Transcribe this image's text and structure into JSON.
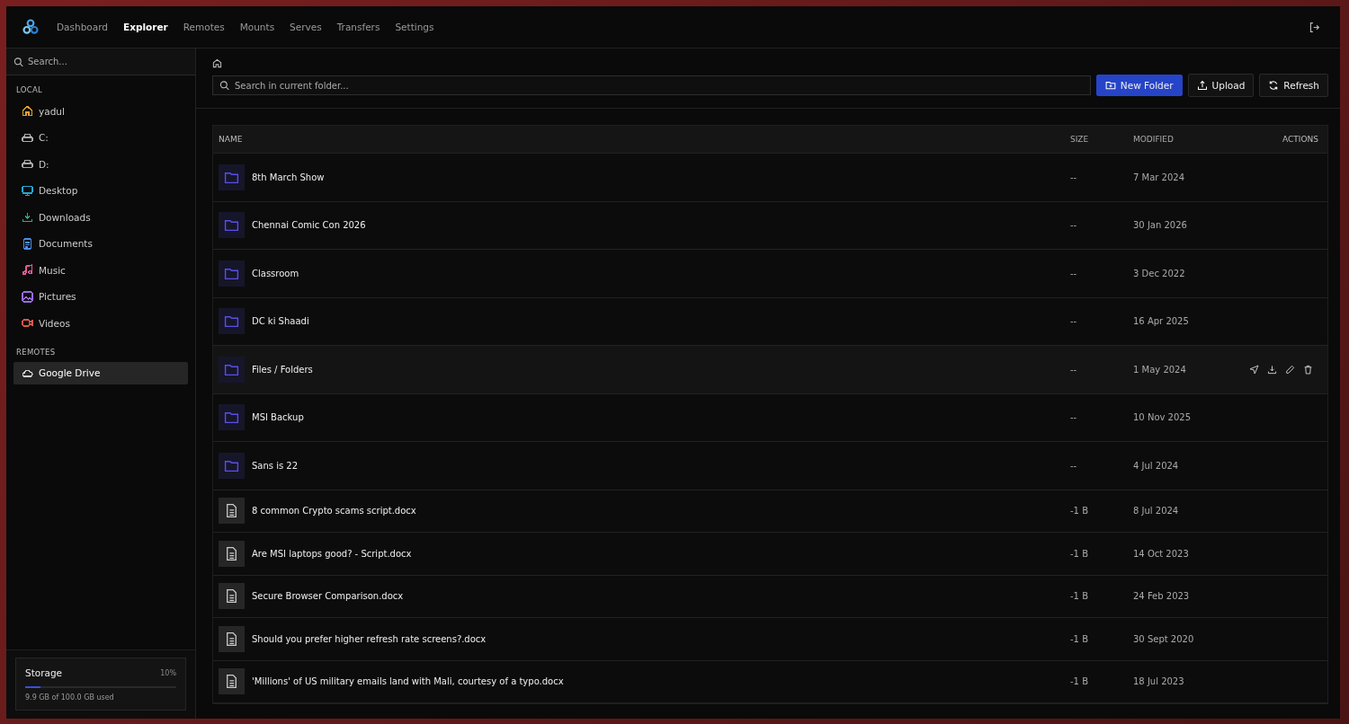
{
  "nav": {
    "tabs": [
      {
        "label": "Dashboard",
        "selected": false
      },
      {
        "label": "Explorer",
        "selected": true
      },
      {
        "label": "Remotes",
        "selected": false
      },
      {
        "label": "Mounts",
        "selected": false
      },
      {
        "label": "Serves",
        "selected": false
      },
      {
        "label": "Transfers",
        "selected": false
      },
      {
        "label": "Settings",
        "selected": false
      }
    ]
  },
  "sidebar": {
    "search": {
      "placeholder": "Search..."
    },
    "sections": [
      {
        "title": "LOCAL",
        "items": [
          {
            "label": "yadul",
            "kind": "home",
            "color": "#e0a030",
            "selected": false
          },
          {
            "label": "C:",
            "kind": "drive",
            "color": "#a8a8a8",
            "selected": false
          },
          {
            "label": "D:",
            "kind": "drive",
            "color": "#a8a8a8",
            "selected": false
          },
          {
            "label": "Desktop",
            "kind": "desktop",
            "color": "#22a8d8",
            "selected": false
          },
          {
            "label": "Downloads",
            "kind": "download",
            "color": "#22b573",
            "selected": false
          },
          {
            "label": "Documents",
            "kind": "document",
            "color": "#4a8ee8",
            "selected": false
          },
          {
            "label": "Music",
            "kind": "music",
            "color": "#e05a9a",
            "selected": false
          },
          {
            "label": "Pictures",
            "kind": "picture",
            "color": "#9b6be8",
            "selected": false
          },
          {
            "label": "Videos",
            "kind": "video",
            "color": "#e0554a",
            "selected": false
          }
        ]
      },
      {
        "title": "REMOTES",
        "items": [
          {
            "label": "Google Drive",
            "kind": "cloud",
            "color": "#d0d0d0",
            "selected": true
          }
        ]
      }
    ],
    "storage": {
      "title": "Storage",
      "percent": "10%",
      "level": 0.1,
      "usage": "9.9 GB of 100.0 GB used"
    }
  },
  "toolbar": {
    "search": {
      "placeholder": "Search in current folder..."
    },
    "buttons": [
      {
        "label": "New Folder",
        "kind": "new-folder",
        "primary": true
      },
      {
        "label": "Upload",
        "kind": "upload",
        "primary": false
      },
      {
        "label": "Refresh",
        "kind": "refresh",
        "primary": false
      }
    ]
  },
  "table": {
    "columns": [
      "NAME",
      "SIZE",
      "MODIFIED",
      "ACTIONS"
    ],
    "rows": [
      {
        "kind": "folder",
        "name": "8th March Show",
        "size": "--",
        "modified": "7 Mar 2024",
        "hovered": false
      },
      {
        "kind": "folder",
        "name": "Chennai Comic Con 2026",
        "size": "--",
        "modified": "30 Jan 2026",
        "hovered": false
      },
      {
        "kind": "folder",
        "name": "Classroom",
        "size": "--",
        "modified": "3 Dec 2022",
        "hovered": false
      },
      {
        "kind": "folder",
        "name": "DC ki Shaadi",
        "size": "--",
        "modified": "16 Apr 2025",
        "hovered": false
      },
      {
        "kind": "folder",
        "name": "Files / Folders",
        "size": "--",
        "modified": "1 May 2024",
        "hovered": true
      },
      {
        "kind": "folder",
        "name": "MSI Backup",
        "size": "--",
        "modified": "10 Nov 2025",
        "hovered": false
      },
      {
        "kind": "folder",
        "name": "Sans is 22",
        "size": "--",
        "modified": "4 Jul 2024",
        "hovered": false
      },
      {
        "kind": "file",
        "name": "8 common Crypto scams script.docx",
        "size": "-1 B",
        "modified": "8 Jul 2024",
        "hovered": false
      },
      {
        "kind": "file",
        "name": "Are MSI laptops good? - Script.docx",
        "size": "-1 B",
        "modified": "14 Oct 2023",
        "hovered": false
      },
      {
        "kind": "file",
        "name": "Secure Browser Comparison.docx",
        "size": "-1 B",
        "modified": "24 Feb 2023",
        "hovered": false
      },
      {
        "kind": "file",
        "name": "Should you prefer higher refresh rate screens?.docx",
        "size": "-1 B",
        "modified": "30 Sept 2020",
        "hovered": false
      },
      {
        "kind": "file",
        "name": "'Millions' of US military emails land with Mali, courtesy of a typo.docx",
        "size": "-1 B",
        "modified": "18 Jul 2023",
        "hovered": false
      }
    ]
  }
}
